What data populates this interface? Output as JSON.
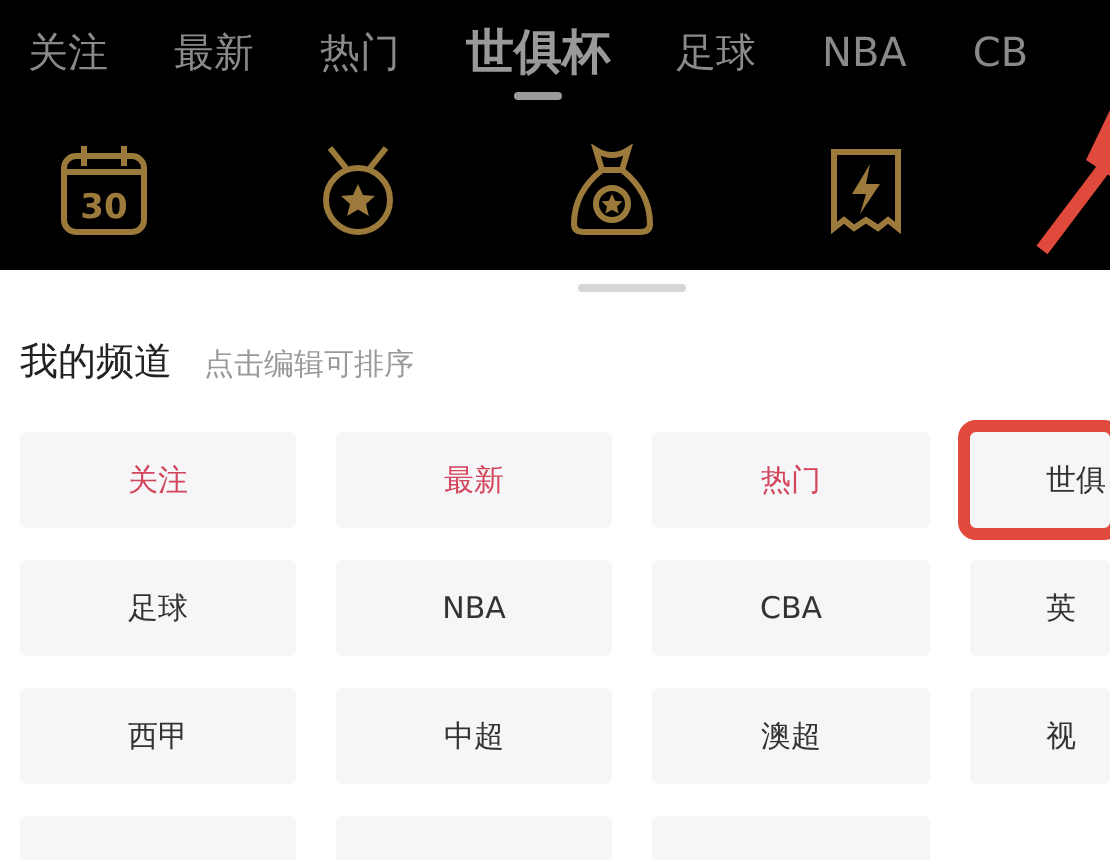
{
  "tabs": [
    {
      "label": "关注",
      "selected": false
    },
    {
      "label": "最新",
      "selected": false
    },
    {
      "label": "热门",
      "selected": false
    },
    {
      "label": "世俱杯",
      "selected": true
    },
    {
      "label": "足球",
      "selected": false
    },
    {
      "label": "NBA",
      "selected": false
    },
    {
      "label": "CB",
      "selected": false
    }
  ],
  "shortcuts": [
    {
      "kind": "calendar",
      "text": "30"
    },
    {
      "kind": "medal"
    },
    {
      "kind": "bag"
    },
    {
      "kind": "card"
    }
  ],
  "annotation": {
    "kind": "arrow"
  },
  "channels": {
    "title": "我的频道",
    "hint": "点击编辑可排序",
    "items": [
      {
        "label": "关注",
        "kind": "fixed",
        "highlighted": false
      },
      {
        "label": "最新",
        "kind": "fixed",
        "highlighted": false
      },
      {
        "label": "热门",
        "kind": "fixed",
        "highlighted": false
      },
      {
        "label": "世俱",
        "kind": "normal",
        "highlighted": true
      },
      {
        "label": "足球",
        "kind": "normal",
        "highlighted": false
      },
      {
        "label": "NBA",
        "kind": "normal",
        "highlighted": false
      },
      {
        "label": "CBA",
        "kind": "normal",
        "highlighted": false
      },
      {
        "label": "英",
        "kind": "normal",
        "highlighted": false
      },
      {
        "label": "西甲",
        "kind": "normal",
        "highlighted": false
      },
      {
        "label": "中超",
        "kind": "normal",
        "highlighted": false
      },
      {
        "label": "澳超",
        "kind": "normal",
        "highlighted": false
      },
      {
        "label": "视",
        "kind": "normal",
        "highlighted": false
      },
      {
        "kind": "cut",
        "highlighted": false
      },
      {
        "kind": "cut",
        "highlighted": false
      },
      {
        "kind": "cut",
        "highlighted": false
      }
    ]
  }
}
